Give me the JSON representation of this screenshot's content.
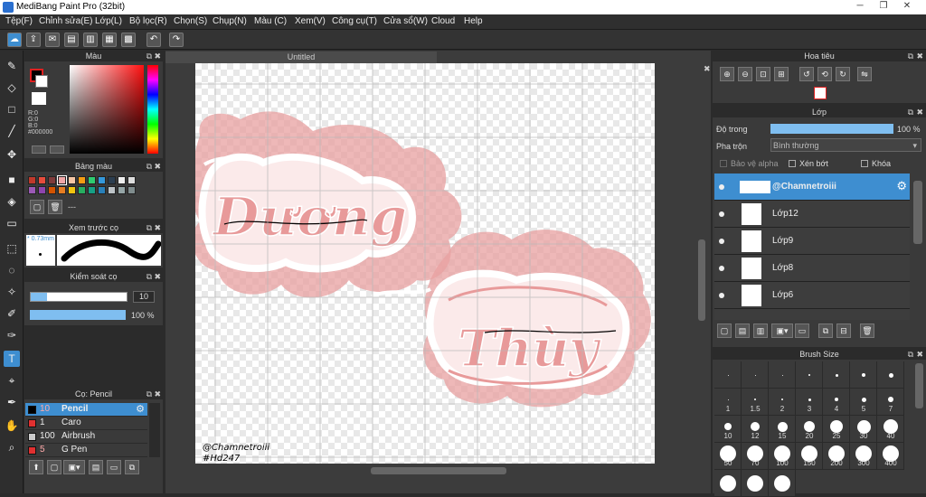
{
  "window": {
    "title": "MediBang Paint Pro (32bit)",
    "min": "─",
    "max": "❐",
    "close": "✕"
  },
  "menu": [
    "Tệp(F)",
    "Chỉnh sửa(E)",
    "Lớp(L)",
    "Bộ lọc(R)",
    "Chọn(S)",
    "Chụp(N)",
    "Màu (C)",
    "Xem(V)",
    "Công cụ(T)",
    "Cửa sổ(W)",
    "Cloud",
    "Help"
  ],
  "color_panel": {
    "title": "Màu",
    "r": "R:0",
    "g": "G:0",
    "b": "B:0",
    "hex": "#000000",
    "fg_color": "#000000",
    "bg_color": "#ffffff"
  },
  "palette_panel": {
    "title": "Bảng màu",
    "more": "---"
  },
  "brush_preview": {
    "title": "Xem trước cọ",
    "size": "* 0.73mm"
  },
  "brush_control": {
    "title": "Kiểm soát cọ",
    "size_value": "10",
    "opacity_value": "100 %"
  },
  "brush_list": {
    "title": "Cọ: Pencil",
    "items": [
      {
        "size": "10",
        "name": "Pencil",
        "color": "#000000"
      },
      {
        "size": "1",
        "name": "Caro",
        "color": "#e03030"
      },
      {
        "size": "100",
        "name": "Airbrush",
        "color": "#cccccc"
      },
      {
        "size": "5",
        "name": "G Pen",
        "color": "#e03030"
      }
    ]
  },
  "document": {
    "tab": "Untitled",
    "signature_1": "@Chamnetroiii",
    "signature_2": "#Hd247",
    "art_text_1": "Dương",
    "art_text_2": "Thùy"
  },
  "navigator": {
    "title": "Hoa tiêu"
  },
  "layers_panel": {
    "title": "Lớp",
    "opacity_label": "Độ trong",
    "opacity_value": "100 %",
    "blend_label": "Pha trộn",
    "blend_value": "Bình thường",
    "protect_alpha": "Bảo vệ alpha",
    "clipping": "Xén bớt",
    "lock": "Khóa",
    "layers": [
      "@Chamnetroiii",
      "Lớp12",
      "Lớp9",
      "Lớp8",
      "Lớp6"
    ]
  },
  "brush_size_panel": {
    "title": "Brush Size",
    "sizes": [
      "",
      "",
      "",
      "",
      "",
      "",
      "",
      "1",
      "1.5",
      "2",
      "3",
      "4",
      "5",
      "7",
      "10",
      "12",
      "15",
      "20",
      "25",
      "30",
      "40",
      "50",
      "70",
      "100",
      "150",
      "200",
      "300",
      "400",
      "",
      "",
      ""
    ]
  },
  "colors": {
    "accent": "#3e8ed0",
    "panel": "#3a3a3a",
    "pink": "#e89a9a"
  }
}
